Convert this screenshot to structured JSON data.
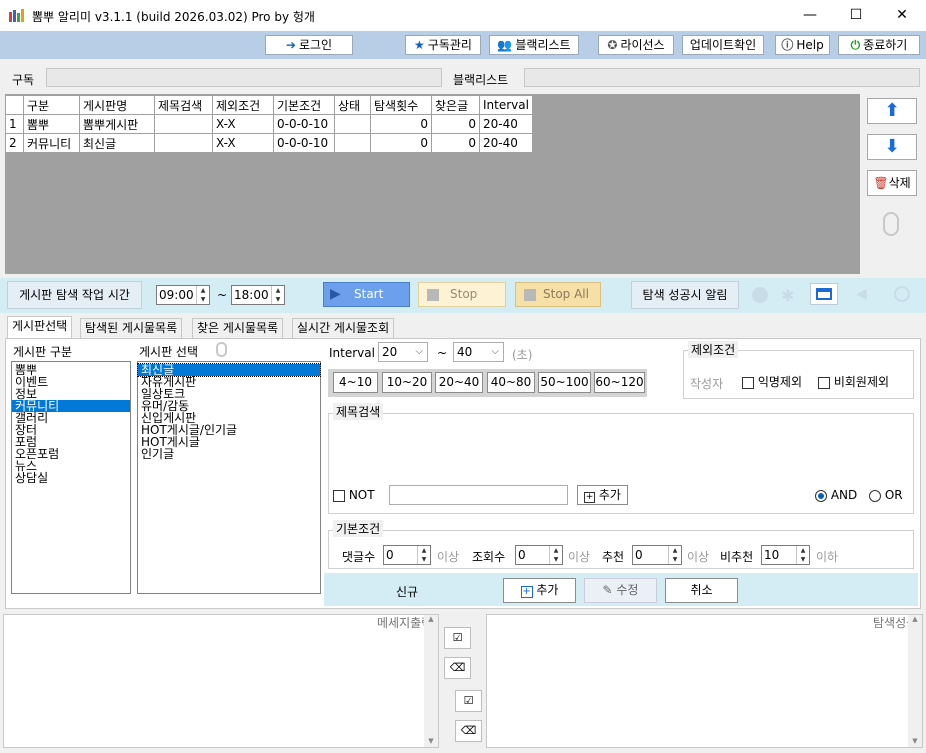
{
  "window": {
    "title": "뽐뿌 알리미 v3.1.1 (build 2026.03.02) Pro by 헝개",
    "minimize": "—",
    "maximize": "☐",
    "close": "✕"
  },
  "toolbar": {
    "login": "로그인",
    "subscribe": "구독관리",
    "blacklist": "블랙리스트",
    "license": "라이선스",
    "update": "업데이트확인",
    "help": "Help",
    "exit": "종료하기"
  },
  "sections": {
    "subscribe_label": "구독",
    "blacklist_label": "블랙리스트"
  },
  "grid": {
    "headers": [
      "구분",
      "게시판명",
      "제목검색",
      "제외조건",
      "기본조건",
      "상태",
      "탐색횟수",
      "찾은글",
      "Interval"
    ],
    "rows": [
      {
        "num": "1",
        "cells": [
          "뽐뿌",
          "뽐뿌게시판",
          "",
          "X-X",
          "0-0-0-10",
          "",
          "0",
          "0",
          "20-40"
        ]
      },
      {
        "num": "2",
        "cells": [
          "커뮤니티",
          "최신글",
          "",
          "X-X",
          "0-0-0-10",
          "",
          "0",
          "0",
          "20-40"
        ]
      }
    ]
  },
  "side": {
    "up": "⬆",
    "down": "⬇",
    "delete": "삭제"
  },
  "timebar": {
    "label": "게시판 탐색 작업 시간",
    "start_time": "09:00",
    "tilde": "~",
    "end_time": "18:00",
    "start": "Start",
    "stop": "Stop",
    "stopall": "Stop All",
    "alert_label": "탐색 성공시 알림"
  },
  "tabs": [
    "게시판선택",
    "탐색된 게시물목록",
    "찾은 게시물목록",
    "실시간 게시물조회"
  ],
  "board": {
    "category_label": "게시판 구분",
    "categories": [
      "뽐뿌",
      "이벤트",
      "정보",
      "커뮤니티",
      "갤러리",
      "장터",
      "포럼",
      "오픈포럼",
      "뉴스",
      "상담실"
    ],
    "board_label": "게시판 선택",
    "boards": [
      "최신글",
      "자유게시판",
      "일상토크",
      "유머/감동",
      "신입게시판",
      "HOT게시글/인기글",
      "HOT게시글",
      "인기글"
    ]
  },
  "interval": {
    "label": "Interval",
    "from": "20",
    "tilde": "~",
    "to": "40",
    "unit": "(초)",
    "presets": [
      "4~10",
      "10~20",
      "20~40",
      "40~80",
      "50~100",
      "60~120"
    ]
  },
  "exclude": {
    "title": "제외조건",
    "author": "작성자",
    "anon": "익명제외",
    "nonmember": "비회원제외"
  },
  "title_search": {
    "title": "제목검색",
    "not": "NOT",
    "add": "추가",
    "and": "AND",
    "or": "OR"
  },
  "basic": {
    "title": "기본조건",
    "comments": "댓글수",
    "comments_val": "0",
    "above1": "이상",
    "views": "조회수",
    "views_val": "0",
    "above2": "이상",
    "likes": "추천",
    "likes_val": "0",
    "above3": "이상",
    "dislikes": "비추천",
    "dislikes_val": "10",
    "below": "이하"
  },
  "actions": {
    "new": "신규",
    "add": "추가",
    "edit": "수정",
    "cancel": "취소"
  },
  "bottom": {
    "message_label": "메세지출력",
    "success_label": "탐색성공"
  }
}
